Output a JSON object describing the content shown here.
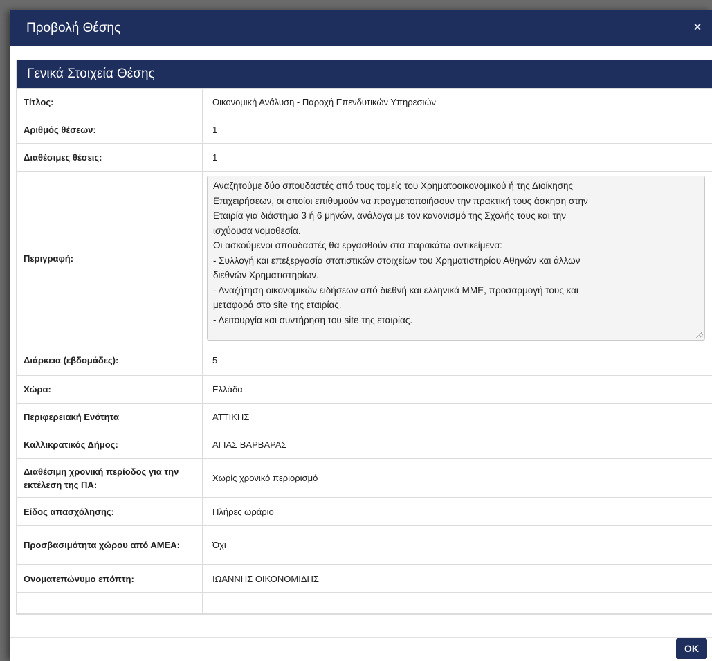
{
  "modal": {
    "title": "Προβολή Θέσης",
    "close_glyph": "×",
    "close_icon": "close-icon"
  },
  "panel": {
    "heading": "Γενικά Στοιχεία Θέσης"
  },
  "rows": {
    "title": {
      "label": "Τίτλος:",
      "value": "Οικονομική Ανάλυση - Παροχή Επενδυτικών Υπηρεσιών"
    },
    "positions": {
      "label": "Αριθμός θέσεων:",
      "value": "1"
    },
    "available": {
      "label": "Διαθέσιμες θέσεις:",
      "value": "1"
    },
    "description": {
      "label": "Περιγραφή:",
      "lines": [
        "Αναζητούμε δύο σπουδαστές από τους τομείς του Χρηματοοικονομικού ή της Διοίκησης",
        "Επιχειρήσεων, οι οποίοι επιθυμούν να πραγματοποιήσουν την πρακτική τους άσκηση στην",
        "Εταιρία για διάστημα 3 ή 6 μηνών, ανάλογα με τον κανονισμό της Σχολής τους και την",
        "ισχύουσα νομοθεσία.",
        "Οι ασκούμενοι σπουδαστές θα εργασθούν στα παρακάτω αντικείμενα:",
        "- Συλλογή και επεξεργασία στατιστικών στοιχείων του Χρηματιστηρίου Αθηνών και άλλων",
        "διεθνών Χρηματιστηρίων.",
        "- Αναζήτηση οικονομικών ειδήσεων από διεθνή και ελληνικά ΜΜΕ, προσαρμογή τους και",
        "μεταφορά στο site της εταιρίας.",
        "- Λειτουργία και συντήρηση του site της εταιρίας."
      ]
    },
    "duration": {
      "label": "Διάρκεια (εβδομάδες):",
      "value": "5"
    },
    "country": {
      "label": "Χώρα:",
      "value": "Ελλάδα"
    },
    "region": {
      "label": "Περιφερειακή Ενότητα",
      "value": "ΑΤΤΙΚΗΣ"
    },
    "municipality": {
      "label": "Καλλικρατικός Δήμος:",
      "value": "ΑΓΙΑΣ ΒΑΡΒΑΡΑΣ"
    },
    "period": {
      "label": "Διαθέσιμη χρονική περίοδος για την εκτέλεση της ΠΑ:",
      "value": "Χωρίς χρονικό περιορισμό"
    },
    "employment": {
      "label": "Είδος απασχόλησης:",
      "value": "Πλήρες ωράριο"
    },
    "accessibility": {
      "label": "Προσβασιμότητα χώρου από ΑΜΕΑ:",
      "value": "Όχι"
    },
    "supervisor": {
      "label": "Ονοματεπώνυμο επόπτη:",
      "value": "ΙΩΑΝΝΗΣ ΟΙΚΟΝΟΜΙΔΗΣ"
    }
  },
  "footer": {
    "ok_label": "OK"
  }
}
